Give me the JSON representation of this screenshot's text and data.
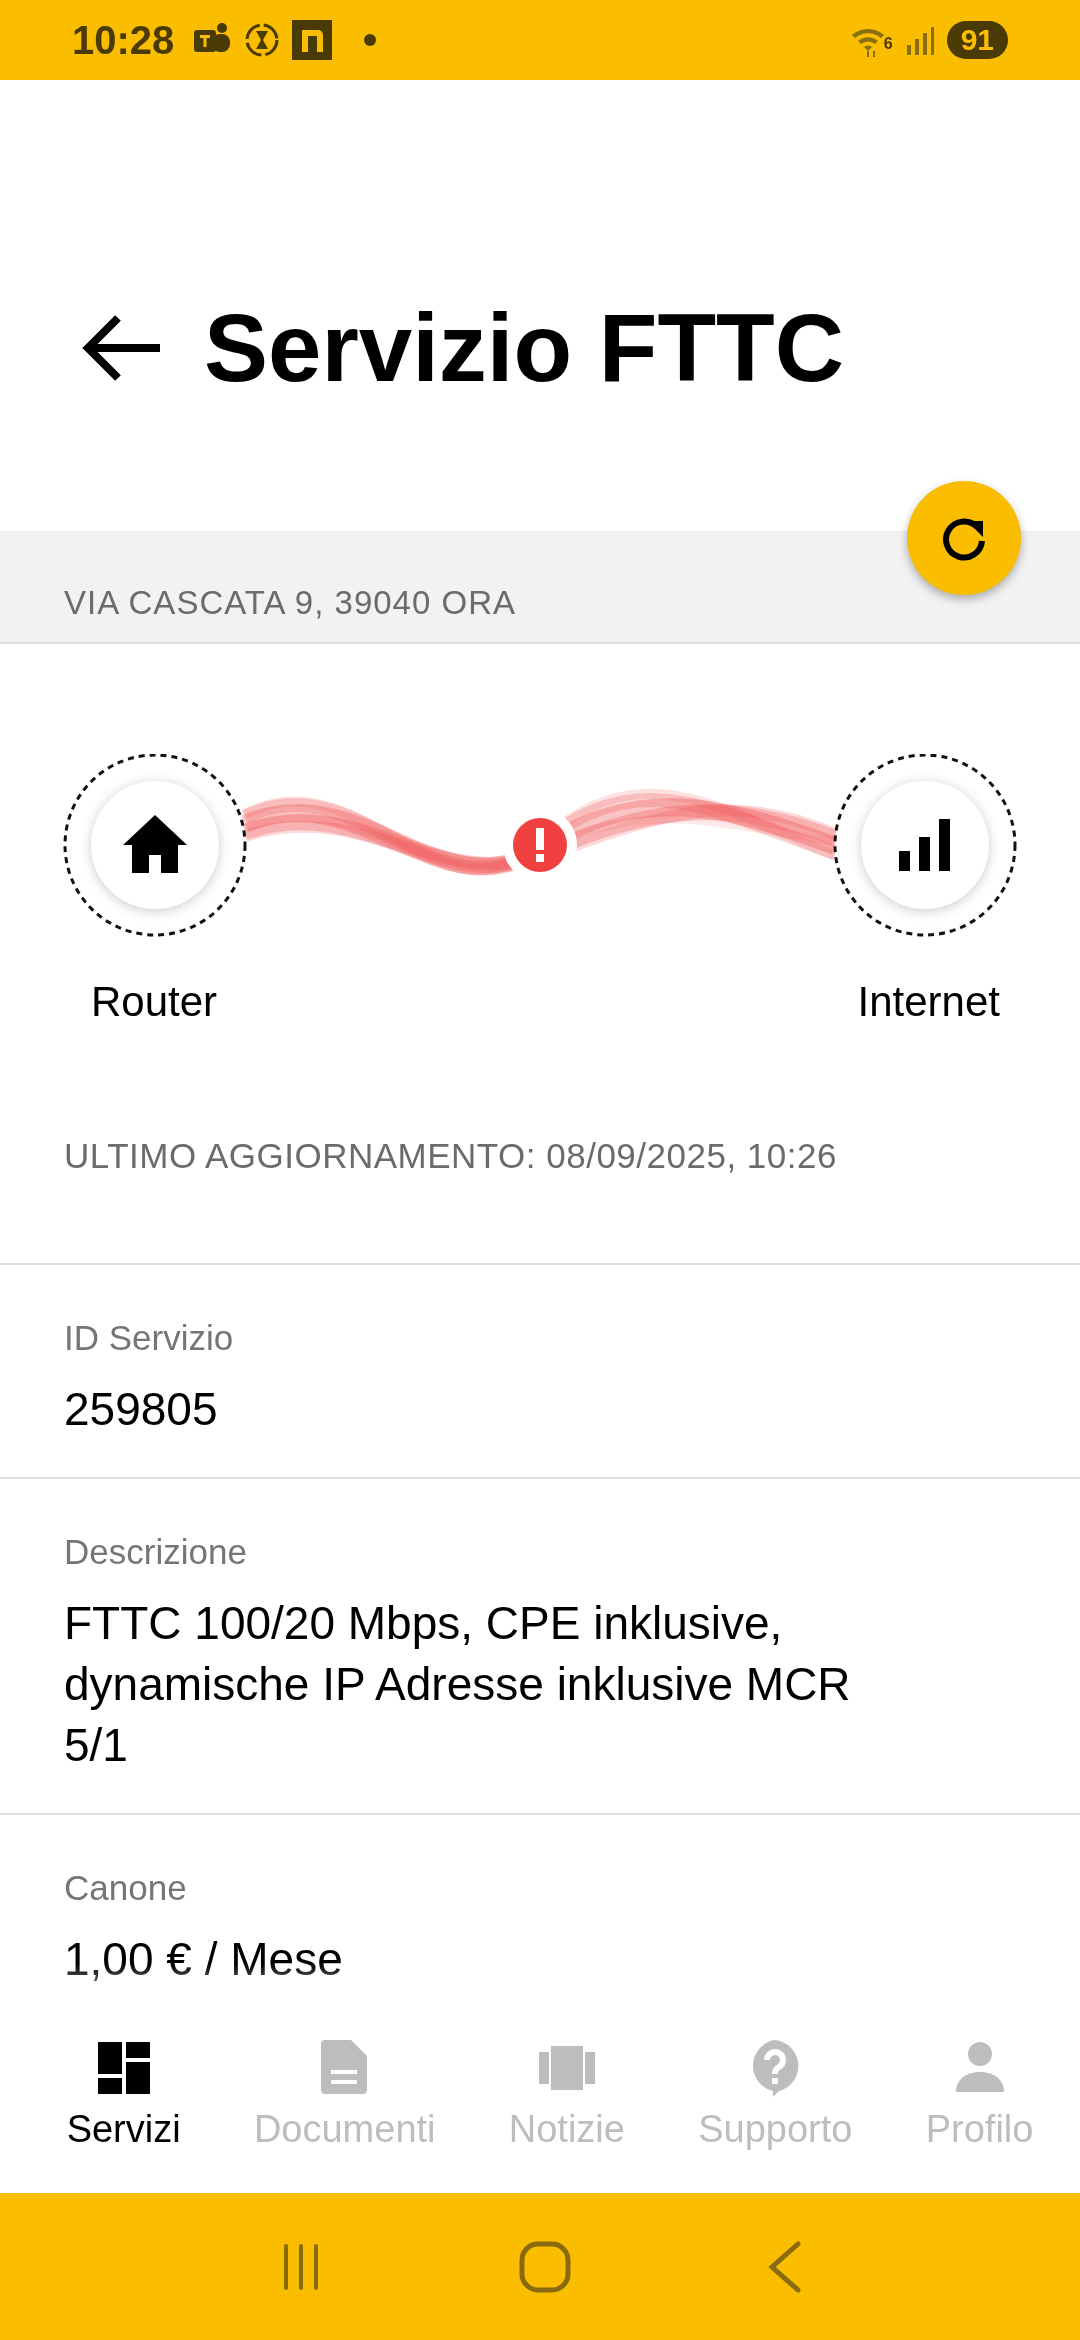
{
  "status_bar": {
    "time": "10:28",
    "network": "6",
    "battery": "91"
  },
  "header": {
    "title": "Servizio FTTC"
  },
  "address": "VIA CASCATA 9, 39040 ORA",
  "connection": {
    "alert": true,
    "nodes": [
      {
        "kind": "home",
        "label": "Router"
      },
      {
        "kind": "signal",
        "label": "Internet"
      }
    ]
  },
  "last_update": "ULTIMO AGGIORNAMENTO: 08/09/2025, 10:26",
  "fields": [
    {
      "label": "ID Servizio",
      "value": "259805"
    },
    {
      "label": "Descrizione",
      "value": "FTTC 100/20 Mbps, CPE inklusive, dynamische IP Adresse inklusive MCR 5/1"
    },
    {
      "label": "Canone",
      "value": "1,00 € / Mese"
    }
  ],
  "nav": [
    {
      "label": "Servizi",
      "selected": true
    },
    {
      "label": "Documenti",
      "selected": false
    },
    {
      "label": "Notizie",
      "selected": false
    },
    {
      "label": "Supporto",
      "selected": false
    },
    {
      "label": "Profilo",
      "selected": false
    }
  ]
}
